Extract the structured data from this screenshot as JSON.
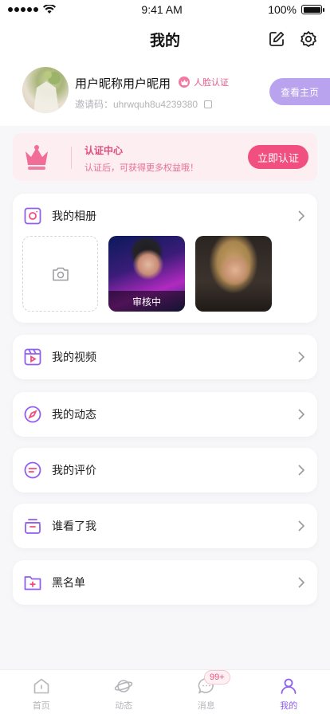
{
  "status_bar": {
    "time": "9:41 AM",
    "battery": "100%"
  },
  "nav": {
    "title": "我的"
  },
  "profile": {
    "nickname": "用户昵称用户昵用",
    "verify_label": "人脸认证",
    "invite_code": "邀请码：uhrwquh8u4239380",
    "home_button": "查看主页"
  },
  "certification": {
    "title": "认证中心",
    "subtitle": "认证后，可获得更多权益哦！",
    "button": "立即认证"
  },
  "album": {
    "label": "我的相册",
    "photos": [
      {
        "status": "审核中"
      },
      {
        "status": ""
      }
    ]
  },
  "menu": [
    {
      "label": "我的视频"
    },
    {
      "label": "我的动态"
    },
    {
      "label": "我的评价"
    },
    {
      "label": "谁看了我"
    },
    {
      "label": "黑名单"
    }
  ],
  "tabbar": {
    "items": [
      {
        "label": "首页"
      },
      {
        "label": "动态"
      },
      {
        "label": "消息"
      },
      {
        "label": "我的"
      }
    ],
    "message_badge": "99+"
  },
  "colors": {
    "accent": "#8f5ff0",
    "pink": "#f04f7f"
  }
}
